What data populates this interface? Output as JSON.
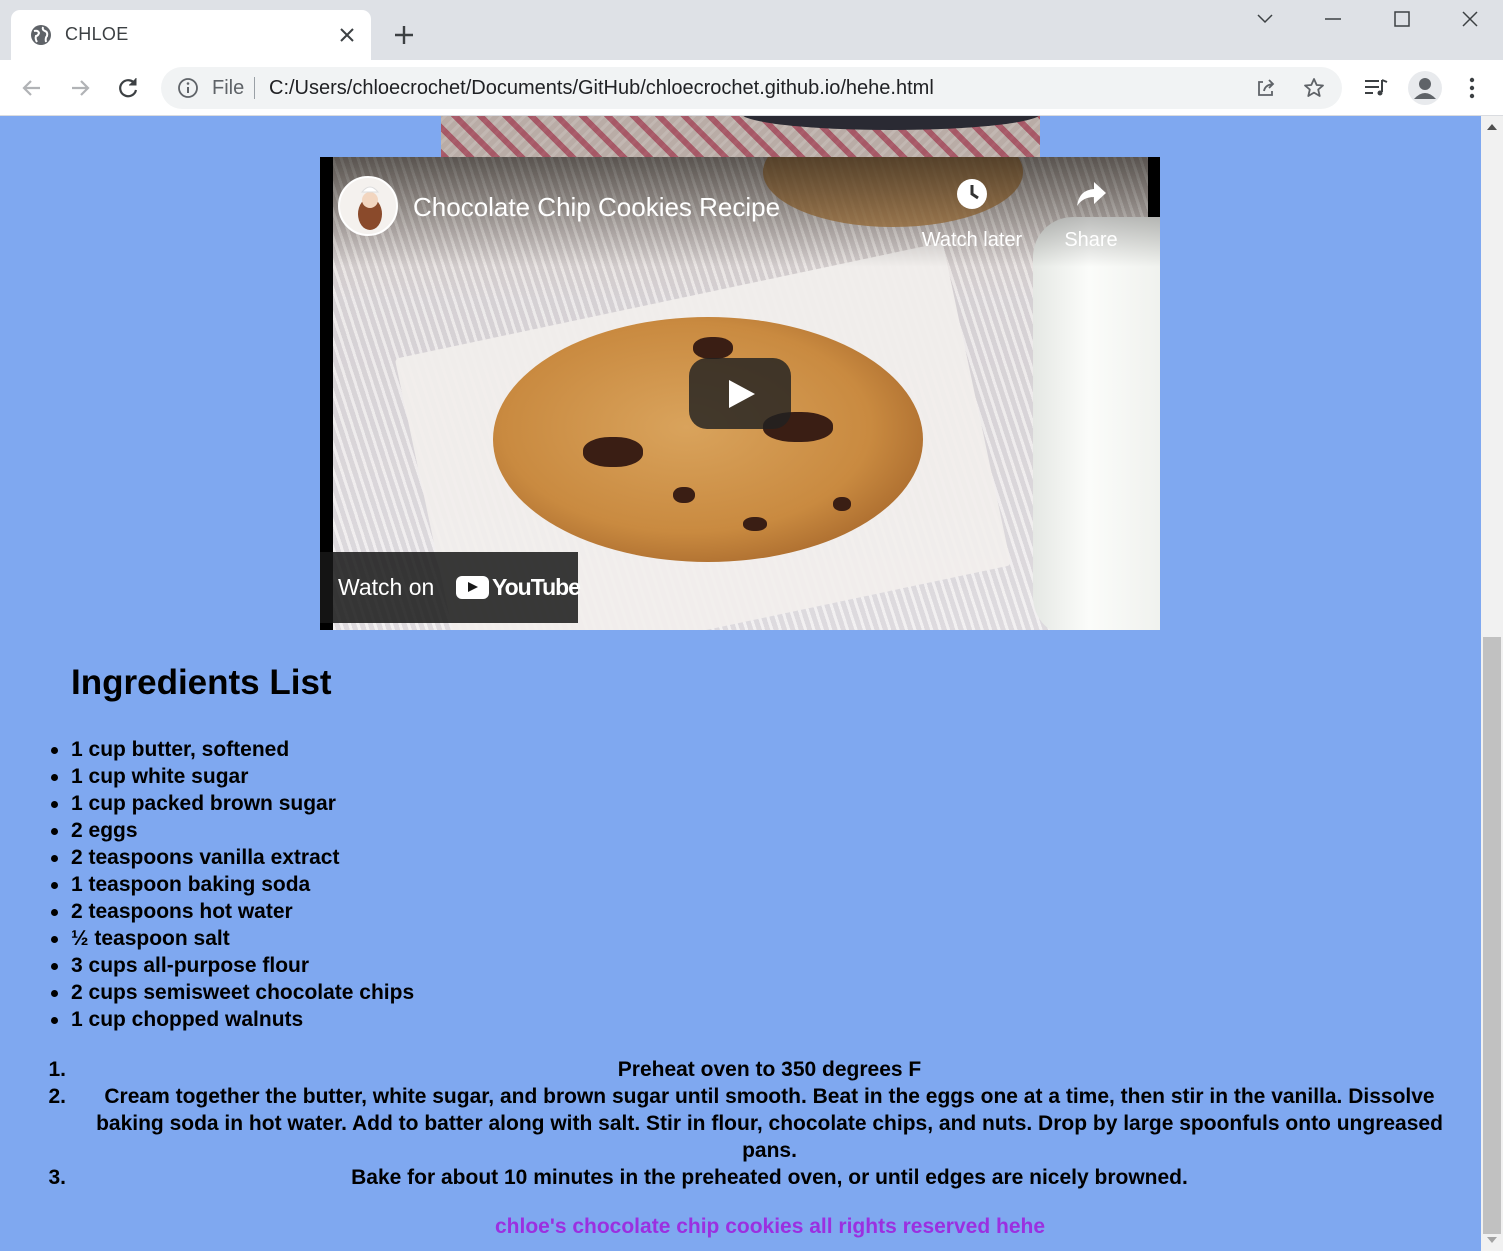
{
  "browser": {
    "tab_title": "CHLOE",
    "omnibox": {
      "scheme_label": "File",
      "url": "C:/Users/chloecrochet/Documents/GitHub/chloecrochet.github.io/hehe.html"
    }
  },
  "video": {
    "title": "Chocolate Chip Cookies Recipe",
    "watch_later": "Watch later",
    "share": "Share",
    "watch_on": "Watch on",
    "youtube_wordmark": "YouTube"
  },
  "page": {
    "background": "#7fa8f0",
    "heading": "Ingredients List",
    "ingredients": [
      "1 cup butter, softened",
      "1 cup white sugar",
      "1 cup packed brown sugar",
      "2 eggs",
      "2 teaspoons vanilla extract",
      "1 teaspoon baking soda",
      "2 teaspoons hot water",
      "½ teaspoon salt",
      "3 cups all-purpose flour",
      "2 cups semisweet chocolate chips",
      "1 cup chopped walnuts"
    ],
    "steps": [
      {
        "num": "1.",
        "text": "Preheat oven to 350 degrees F"
      },
      {
        "num": "2.",
        "text": "Cream together the butter, white sugar, and brown sugar until smooth. Beat in the eggs one at a time, then stir in the vanilla. Dissolve baking soda in hot water. Add to batter along with salt. Stir in flour, chocolate chips, and nuts. Drop by large spoonfuls onto ungreased pans."
      },
      {
        "num": "3.",
        "text": "Bake for about 10 minutes in the preheated oven, or until edges are nicely browned."
      }
    ],
    "footer": "chloe's chocolate chip cookies all rights reserved hehe",
    "footer_color": "#9b30e0"
  }
}
